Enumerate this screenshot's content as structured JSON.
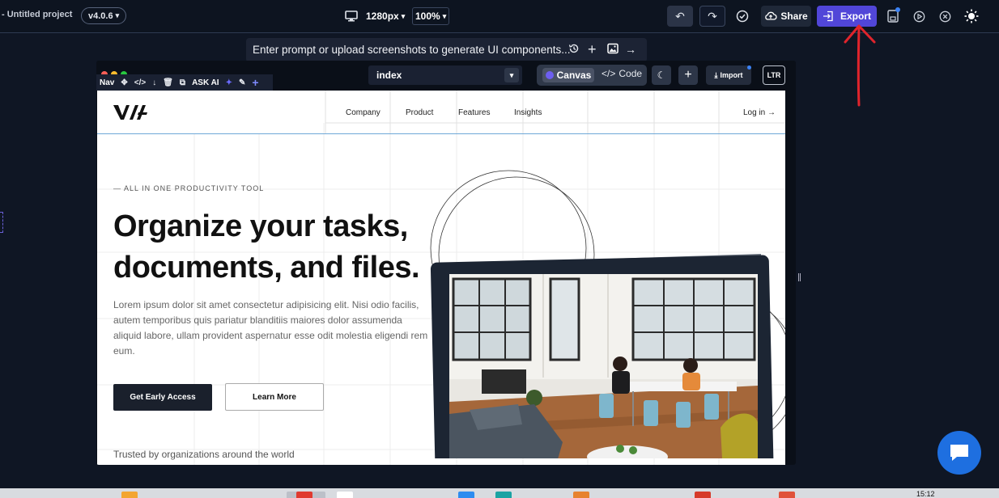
{
  "app": {
    "project_title": "- Untitled project",
    "version": "v4.0.6",
    "device_icon": "desktop-icon",
    "width_select": "1280px",
    "zoom_select": "100%",
    "share_label": "Share",
    "export_label": "Export",
    "accent_color": "#5146d8"
  },
  "prompt": {
    "placeholder": "Enter prompt or upload screenshots to generate UI components..."
  },
  "canvas_window": {
    "nav_label": "Nav",
    "ask_ai_label": "ASK AI",
    "page_select": "index",
    "tab_canvas": "Canvas",
    "tab_code": "Code",
    "import_label": "Import",
    "ltr_label": "LTR"
  },
  "site": {
    "nav_links": [
      "Company",
      "Product",
      "Features",
      "Insights"
    ],
    "login_label": "Log in →",
    "eyebrow": "— ALL IN ONE PRODUCTIVITY TOOL",
    "hero_title": "Organize your tasks, documents, and files.",
    "hero_text": "Lorem ipsum dolor sit amet consectetur adipisicing elit. Nisi odio facilis, autem temporibus quis pariatur blanditiis maiores dolor assumenda aliquid labore, ullam provident aspernatur esse odit molestia eligendi rem eum.",
    "cta_primary": "Get Early Access",
    "cta_secondary": "Learn More",
    "trusted_text": "Trusted by organizations around the world"
  },
  "taskbar": {
    "clock": "15:12"
  }
}
